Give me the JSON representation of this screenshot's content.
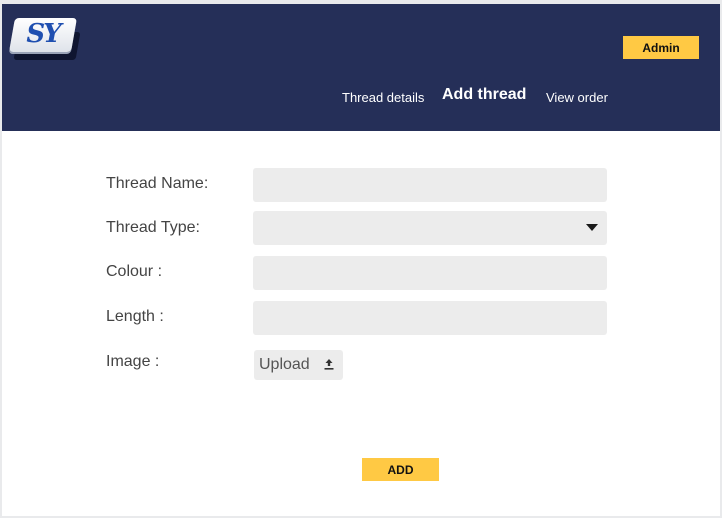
{
  "header": {
    "logo_text": "SY",
    "admin_label": "Admin",
    "nav": [
      {
        "label": "Thread details",
        "active": false
      },
      {
        "label": "Add thread",
        "active": true
      },
      {
        "label": "View order",
        "active": false
      }
    ]
  },
  "form": {
    "thread_name_label": "Thread Name:",
    "thread_name_value": "",
    "thread_type_label": "Thread Type:",
    "thread_type_value": "",
    "colour_label": "Colour :",
    "colour_value": "",
    "length_label": "Length :",
    "length_value": "",
    "image_label": "Image :",
    "upload_label": "Upload",
    "upload_icon": "upload-icon",
    "submit_label": "ADD"
  },
  "colors": {
    "header_bg": "#252f58",
    "accent": "#ffc944",
    "field_bg": "#ececec"
  }
}
